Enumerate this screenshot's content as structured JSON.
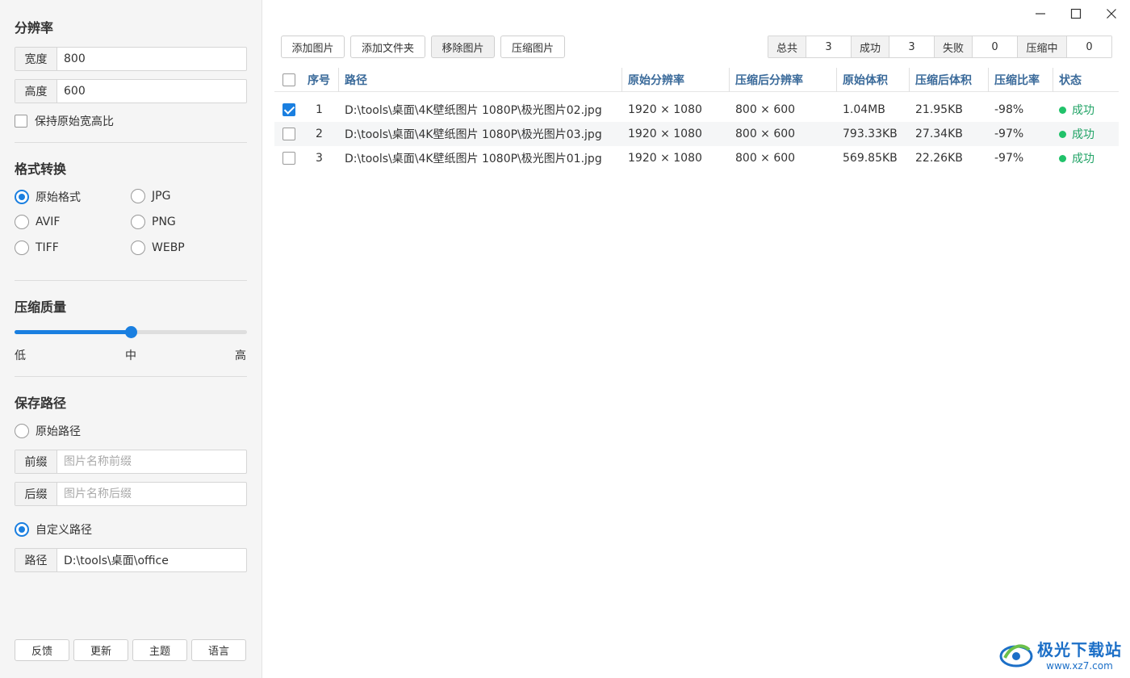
{
  "sidebar": {
    "resolution": {
      "title": "分辨率",
      "width_label": "宽度",
      "width_value": "800",
      "height_label": "高度",
      "height_value": "600",
      "keep_ratio_label": "保持原始宽高比",
      "keep_ratio_checked": false
    },
    "format": {
      "title": "格式转换",
      "options": [
        "原始格式",
        "JPG",
        "AVIF",
        "PNG",
        "TIFF",
        "WEBP"
      ],
      "selected": "原始格式"
    },
    "quality": {
      "title": "压缩质量",
      "labels": [
        "低",
        "中",
        "高"
      ],
      "value_fraction": 0.5
    },
    "save": {
      "title": "保存路径",
      "original_label": "原始路径",
      "prefix_label": "前缀",
      "prefix_placeholder": "图片名称前缀",
      "suffix_label": "后缀",
      "suffix_placeholder": "图片名称后缀",
      "custom_label": "自定义路径",
      "path_label": "路径",
      "path_value": "D:\\tools\\桌面\\office",
      "selected": "自定义路径"
    },
    "footer_buttons": [
      "反馈",
      "更新",
      "主题",
      "语言"
    ]
  },
  "toolbar": {
    "add_image": "添加图片",
    "add_folder": "添加文件夹",
    "remove_image": "移除图片",
    "compress_image": "压缩图片"
  },
  "stats": {
    "total_label": "总共",
    "total": "3",
    "success_label": "成功",
    "success": "3",
    "fail_label": "失败",
    "fail": "0",
    "compressing_label": "压缩中",
    "compressing": "0"
  },
  "table": {
    "columns": [
      "序号",
      "路径",
      "原始分辨率",
      "压缩后分辨率",
      "原始体积",
      "压缩后体积",
      "压缩比率",
      "状态"
    ],
    "rows": [
      {
        "index": "1",
        "path": "D:\\tools\\桌面\\4K壁纸图片 1080P\\极光图片02.jpg",
        "orig_res": "1920 × 1080",
        "new_res": "800 × 600",
        "orig_size": "1.04MB",
        "new_size": "21.95KB",
        "ratio": "-98%",
        "status": "成功",
        "checked": true
      },
      {
        "index": "2",
        "path": "D:\\tools\\桌面\\4K壁纸图片 1080P\\极光图片03.jpg",
        "orig_res": "1920 × 1080",
        "new_res": "800 × 600",
        "orig_size": "793.33KB",
        "new_size": "27.34KB",
        "ratio": "-97%",
        "status": "成功",
        "checked": false
      },
      {
        "index": "3",
        "path": "D:\\tools\\桌面\\4K壁纸图片 1080P\\极光图片01.jpg",
        "orig_res": "1920 × 1080",
        "new_res": "800 × 600",
        "orig_size": "569.85KB",
        "new_size": "22.26KB",
        "ratio": "-97%",
        "status": "成功",
        "checked": false
      }
    ]
  },
  "watermark": {
    "name": "极光下载站",
    "url": "www.xz7.com"
  },
  "colors": {
    "accent": "#1a7fe0",
    "success": "#21a366",
    "header_text": "#3a6a9a"
  }
}
